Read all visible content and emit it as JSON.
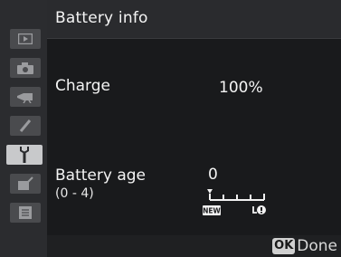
{
  "header": {
    "title": "Battery info"
  },
  "sidebar": {
    "items": [
      {
        "icon": "playback-icon",
        "active": false
      },
      {
        "icon": "camera-icon",
        "active": false
      },
      {
        "icon": "movie-camera-icon",
        "active": false
      },
      {
        "icon": "pencil-icon",
        "active": false
      },
      {
        "icon": "wrench-icon",
        "active": true
      },
      {
        "icon": "retouch-icon",
        "active": false
      },
      {
        "icon": "my-menu-icon",
        "active": false
      }
    ]
  },
  "charge": {
    "label": "Charge",
    "value": "100%"
  },
  "battery_age": {
    "label": "Battery age",
    "range": "(0 - 4)",
    "value": "0",
    "level": 0,
    "max": 4,
    "new_badge": "NEW"
  },
  "footer": {
    "ok_label": "OK",
    "done_label": "Done"
  }
}
